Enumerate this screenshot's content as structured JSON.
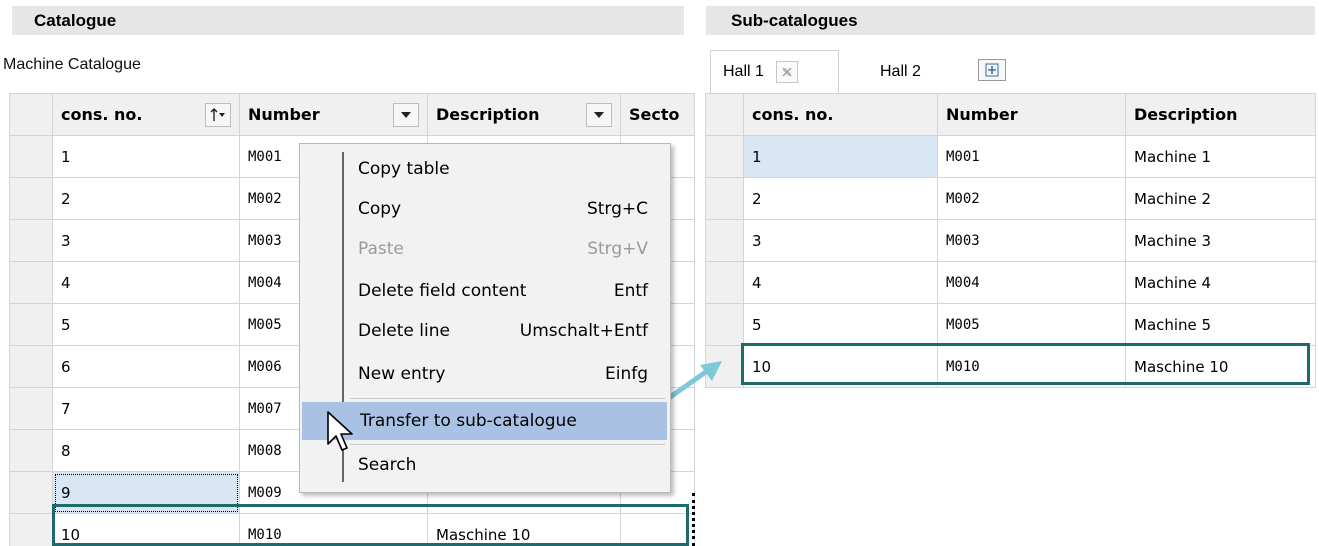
{
  "catalogue": {
    "title": "Catalogue",
    "caption": "Machine Catalogue",
    "columns": [
      "cons. no.",
      "Number",
      "Description",
      "Secto"
    ],
    "rows": [
      {
        "cons": "1",
        "number": "M001",
        "description": "",
        "sector": ""
      },
      {
        "cons": "2",
        "number": "M002",
        "description": "",
        "sector": ""
      },
      {
        "cons": "3",
        "number": "M003",
        "description": "",
        "sector": ""
      },
      {
        "cons": "4",
        "number": "M004",
        "description": "",
        "sector": ""
      },
      {
        "cons": "5",
        "number": "M005",
        "description": "",
        "sector": ""
      },
      {
        "cons": "6",
        "number": "M006",
        "description": "",
        "sector": ""
      },
      {
        "cons": "7",
        "number": "M007",
        "description": "",
        "sector": ""
      },
      {
        "cons": "8",
        "number": "M008",
        "description": "",
        "sector": ""
      },
      {
        "cons": "9",
        "number": "M009",
        "description": "",
        "sector": ""
      },
      {
        "cons": "10",
        "number": "M010",
        "description": "Maschine 10",
        "sector": ""
      }
    ]
  },
  "sub_catalogues": {
    "title": "Sub-catalogues",
    "tabs": [
      {
        "label": "Hall 1",
        "active": true
      },
      {
        "label": "Hall 2",
        "active": false
      }
    ],
    "columns": [
      "cons. no.",
      "Number",
      "Description"
    ],
    "rows": [
      {
        "cons": "1",
        "number": "M001",
        "description": "Machine 1"
      },
      {
        "cons": "2",
        "number": "M002",
        "description": "Machine 2"
      },
      {
        "cons": "3",
        "number": "M003",
        "description": "Machine 3"
      },
      {
        "cons": "4",
        "number": "M004",
        "description": "Machine 4"
      },
      {
        "cons": "5",
        "number": "M005",
        "description": "Machine 5"
      },
      {
        "cons": "10",
        "number": "M010",
        "description": "Maschine 10"
      }
    ]
  },
  "context_menu": {
    "items": [
      {
        "label": "Copy table",
        "shortcut": ""
      },
      {
        "label": "Copy",
        "shortcut": "Strg+C"
      },
      {
        "label": "Paste",
        "shortcut": "Strg+V",
        "disabled": true
      },
      {
        "label": "Delete field content",
        "shortcut": "Entf"
      },
      {
        "label": "Delete line",
        "shortcut": "Umschalt+Entf"
      },
      {
        "label": "New entry",
        "shortcut": "Einfg"
      },
      {
        "label": "Transfer to sub-catalogue",
        "shortcut": "",
        "hovered": true
      },
      {
        "label": "Search",
        "shortcut": ""
      }
    ]
  },
  "colors": {
    "highlight_border": "#1f6b6b",
    "menu_hover": "#a9c1e3",
    "selected_cell": "#d9e7f4",
    "arrow": "#7ec8d8"
  },
  "icons": {
    "sort": "sort-ascending-icon",
    "dropdown": "chevron-down-icon",
    "tab_close": "close-icon",
    "tab_add": "plus-icon",
    "cursor": "mouse-pointer-icon",
    "arrow": "transfer-arrow-icon"
  }
}
